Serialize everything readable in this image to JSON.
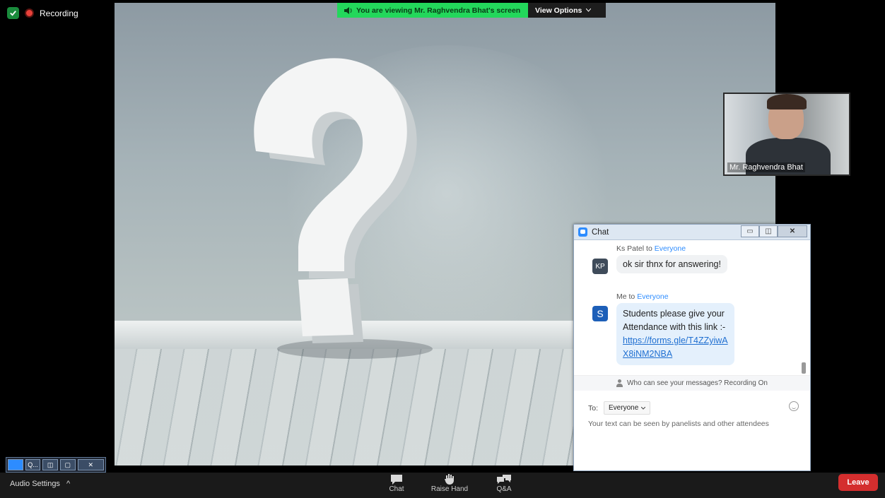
{
  "status": {
    "recording_label": "Recording"
  },
  "share_bar": {
    "viewing_text": "You are viewing Mr. Raghvendra Bhat's screen",
    "view_options_label": "View Options"
  },
  "video": {
    "participant_name": "Mr. Raghvendra Bhat"
  },
  "chat": {
    "title": "Chat",
    "messages": [
      {
        "sender": "Ks Patel",
        "connector": "to",
        "recipient": "Everyone",
        "avatar": "KP",
        "text": "ok sir thnx for answering!"
      },
      {
        "sender": "Me",
        "connector": "to",
        "recipient": "Everyone",
        "avatar": "S",
        "text": "Students  please give your Attendance with this link :-",
        "link": "https://forms.gle/T4ZZyiwAX8iNM2NBA"
      }
    ],
    "visibility_note": "Who can see your messages? Recording On",
    "to_label": "To:",
    "to_value": "Everyone",
    "input_placeholder": "Your text can be seen by panelists and other attendees"
  },
  "mini_panel": {
    "label": "Q..."
  },
  "toolbar": {
    "audio_settings_label": "Audio Settings",
    "chat_label": "Chat",
    "raise_hand_label": "Raise Hand",
    "qa_label": "Q&A",
    "leave_label": "Leave"
  },
  "colors": {
    "accent": "#2d8cff",
    "share_banner": "#23d75b",
    "leave": "#d42e2e",
    "recording": "#e8413a"
  },
  "icons": [
    "shield-check-icon",
    "recording-dot-icon",
    "speaker-icon",
    "chevron-down-icon",
    "chat-icon",
    "minimize-icon",
    "restore-icon",
    "close-icon",
    "people-icon",
    "emoji-icon",
    "raise-hand-icon",
    "qa-icon",
    "chevron-up-icon"
  ]
}
